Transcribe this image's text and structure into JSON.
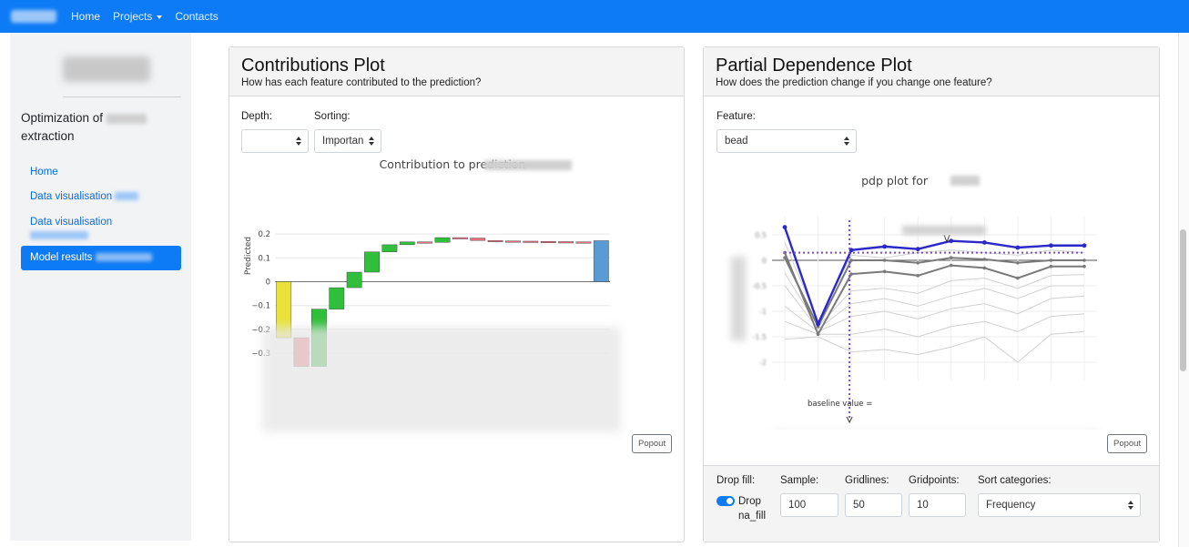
{
  "navbar": {
    "brand_color": "#0d7bf5",
    "links": [
      "Home",
      "Projects",
      "Contacts"
    ]
  },
  "sidebar": {
    "project_title_prefix": "Optimization of",
    "project_title_suffix": "extraction",
    "items": [
      {
        "label": "Home",
        "active": false
      },
      {
        "label": "Data visualisation",
        "active": false
      },
      {
        "label": "Data visualisation",
        "active": false
      },
      {
        "label": "Model results",
        "active": true
      }
    ]
  },
  "contributions": {
    "title": "Contributions Plot",
    "subtitle": "How has each feature contributed to the prediction?",
    "depth_label": "Depth:",
    "depth_value": "",
    "sorting_label": "Sorting:",
    "sorting_value": "Importan",
    "popout_label": "Popout",
    "chart_title": "Contribution to prediction",
    "ylabel": "Predicted",
    "yticks": [
      "0.2",
      "0.1",
      "0",
      "−0.1",
      "−0.2",
      "−0.3"
    ]
  },
  "pdp": {
    "title": "Partial Dependence Plot",
    "subtitle": "How does the prediction change if you change one feature?",
    "feature_label": "Feature:",
    "feature_value": "bead",
    "chart_title": "pdp plot for",
    "baseline_value_label": "baseline value =",
    "popout_label": "Popout",
    "footer": {
      "drop_fill_label": "Drop fill:",
      "drop_fill_toggle_text": "Drop na_fill",
      "sample_label": "Sample:",
      "sample_value": "100",
      "gridlines_label": "Gridlines:",
      "gridlines_value": "50",
      "gridpoints_label": "Gridpoints:",
      "gridpoints_value": "10",
      "sort_label": "Sort categories:",
      "sort_value": "Frequency"
    }
  },
  "chart_data": [
    {
      "type": "bar",
      "subtype": "waterfall",
      "title": "Contribution to prediction",
      "ylabel": "Predicted",
      "ylim": [
        -0.35,
        0.22
      ],
      "bars": [
        {
          "base": 0,
          "value": -0.235,
          "color": "#e8e23a"
        },
        {
          "base": -0.235,
          "value": -0.12,
          "color": "#ec6e7d"
        },
        {
          "base": -0.355,
          "value": 0.24,
          "color": "#2fbf3a"
        },
        {
          "base": -0.115,
          "value": 0.09,
          "color": "#2fbf3a"
        },
        {
          "base": -0.025,
          "value": 0.065,
          "color": "#2fbf3a"
        },
        {
          "base": 0.04,
          "value": 0.085,
          "color": "#2fbf3a"
        },
        {
          "base": 0.125,
          "value": 0.03,
          "color": "#2fbf3a"
        },
        {
          "base": 0.155,
          "value": 0.012,
          "color": "#2fbf3a"
        },
        {
          "base": 0.167,
          "value": -0.002,
          "color": "#ec6e7d"
        },
        {
          "base": 0.165,
          "value": 0.02,
          "color": "#2fbf3a"
        },
        {
          "base": 0.185,
          "value": -0.002,
          "color": "#ec6e7d"
        },
        {
          "base": 0.183,
          "value": -0.01,
          "color": "#ec6e7d"
        },
        {
          "base": 0.173,
          "value": -0.002,
          "color": "#ec6e7d"
        },
        {
          "base": 0.171,
          "value": -0.001,
          "color": "#ec6e7d"
        },
        {
          "base": 0.17,
          "value": -0.001,
          "color": "#ec6e7d"
        },
        {
          "base": 0.169,
          "value": -0.001,
          "color": "#ec6e7d"
        },
        {
          "base": 0.168,
          "value": -0.001,
          "color": "#ec6e7d"
        },
        {
          "base": 0.167,
          "value": -0.001,
          "color": "#ec6e7d"
        },
        {
          "base": 0,
          "value": 0.172,
          "color": "#5b9bd5"
        }
      ]
    },
    {
      "type": "line",
      "title": "pdp plot for",
      "n_points": 10,
      "yticks": [
        "0.5",
        "0",
        "-0.5",
        "-1",
        "-1.5",
        "-2"
      ],
      "ylim": [
        -2.15,
        0.7
      ],
      "series": [
        {
          "role": "average",
          "color": "#2b28c9",
          "values": [
            0.65,
            -1.25,
            0.2,
            0.27,
            0.22,
            0.38,
            0.35,
            0.25,
            0.29,
            0.29
          ]
        },
        {
          "role": "ice-dark",
          "color": "#7a7a7a",
          "values": [
            0.15,
            -1.45,
            -0.27,
            -0.22,
            -0.3,
            -0.1,
            -0.15,
            -0.35,
            -0.12,
            -0.12
          ]
        },
        {
          "role": "ice-dark",
          "color": "#7a7a7a",
          "values": [
            0.05,
            -1.3,
            0.0,
            0.0,
            -0.05,
            0.05,
            0.02,
            -0.05,
            0.0,
            0.0
          ]
        },
        {
          "role": "ice-light",
          "color": "#d0d0d0",
          "values": [
            -0.25,
            -1.3,
            -0.6,
            -0.55,
            -0.65,
            -0.4,
            -0.35,
            -0.55,
            -0.3,
            -0.28
          ]
        },
        {
          "role": "ice-light",
          "color": "#d0d0d0",
          "values": [
            -0.5,
            -1.35,
            -0.85,
            -0.75,
            -0.9,
            -0.7,
            -0.55,
            -0.75,
            -0.5,
            -0.5
          ]
        },
        {
          "role": "ice-light",
          "color": "#d0d0d0",
          "values": [
            -0.9,
            -1.4,
            -1.1,
            -1.0,
            -1.15,
            -0.95,
            -0.85,
            -1.05,
            -0.75,
            -0.7
          ]
        },
        {
          "role": "ice-light",
          "color": "#d0d0d0",
          "values": [
            -1.2,
            -1.45,
            -1.45,
            -1.35,
            -1.5,
            -1.3,
            -1.2,
            -1.4,
            -1.1,
            -1.05
          ]
        },
        {
          "role": "ice-light",
          "color": "#d0d0d0",
          "values": [
            -1.55,
            -1.5,
            -1.8,
            -1.75,
            -1.85,
            -1.7,
            -1.5,
            -2.0,
            -1.45,
            -1.4
          ]
        },
        {
          "role": "ice-light",
          "color": "#d0d0d0",
          "values": [
            0.35,
            -1.2,
            0.1,
            0.05,
            0.15,
            0.2,
            0.15,
            0.1,
            0.2,
            0.15
          ]
        }
      ],
      "baseline_pred": 0.15,
      "baseline_value_index": 2
    }
  ]
}
